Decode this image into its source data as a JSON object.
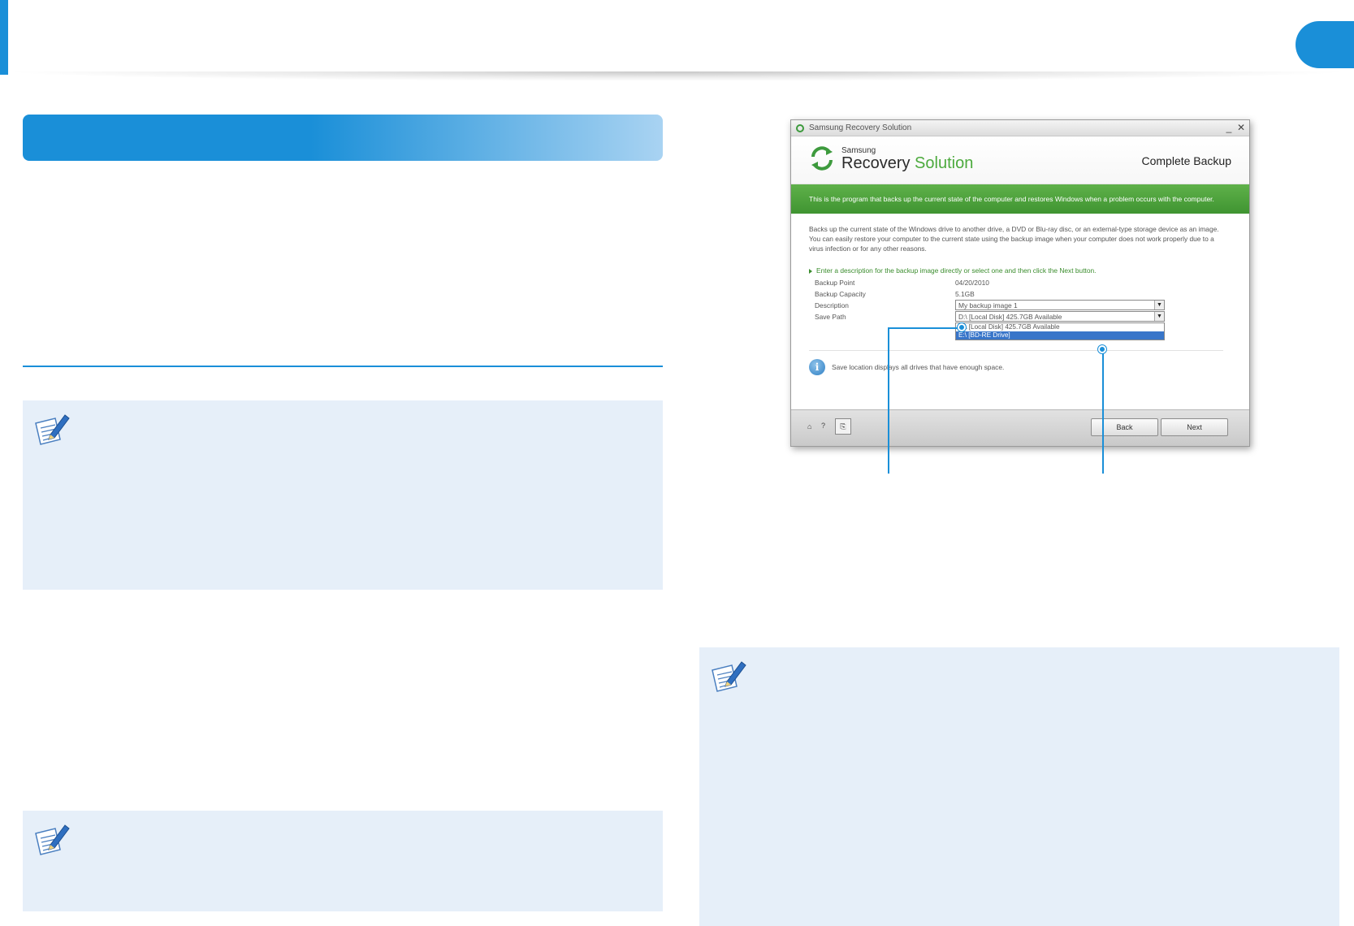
{
  "window": {
    "title": "Samsung Recovery Solution",
    "min_label": "_",
    "close_label": "✕"
  },
  "header": {
    "brand_small": "Samsung",
    "brand_part1": "Recovery",
    "brand_part2": "Solution",
    "page_title": "Complete Backup"
  },
  "banner_text": "This is the program that backs up the current state of the computer and restores Windows when a problem occurs with the computer.",
  "description_lines": [
    "Backs up the current state of the Windows drive to another drive, a DVD or Blu-ray disc, or an external-type storage device as an image.",
    "You can easily restore your computer to the current state using the backup image when your computer does not work properly due to a",
    "virus infection or for any other reasons."
  ],
  "instruction": "Enter a description for the backup image directly or select one and then click the Next button.",
  "fields": {
    "backup_point_label": "Backup Point",
    "backup_point_value": "04/20/2010",
    "backup_capacity_label": "Backup Capacity",
    "backup_capacity_value": "5.1GB",
    "description_label": "Description",
    "description_value": "My backup image 1",
    "save_path_label": "Save Path",
    "save_path_value": "D:\\ [Local Disk]  425.7GB Available"
  },
  "dropdown_options": [
    "D:\\ [Local Disk]  425.7GB Available",
    "E:\\ [BD-RE Drive]"
  ],
  "info_text": "Save location displays all drives that have enough space.",
  "footer": {
    "home_icon": "⌂",
    "help_icon": "?",
    "tool_icon": "⎘",
    "back_label": "Back",
    "next_label": "Next"
  },
  "icons": {
    "note": "note-pencil-icon",
    "info": "info-icon",
    "logo": "refresh-arrows-icon"
  },
  "colors": {
    "accent_blue": "#1a8fd8",
    "note_bg": "#e6eff9",
    "green_bar": "#4a9f3a",
    "selected_option": "#3875c9"
  }
}
